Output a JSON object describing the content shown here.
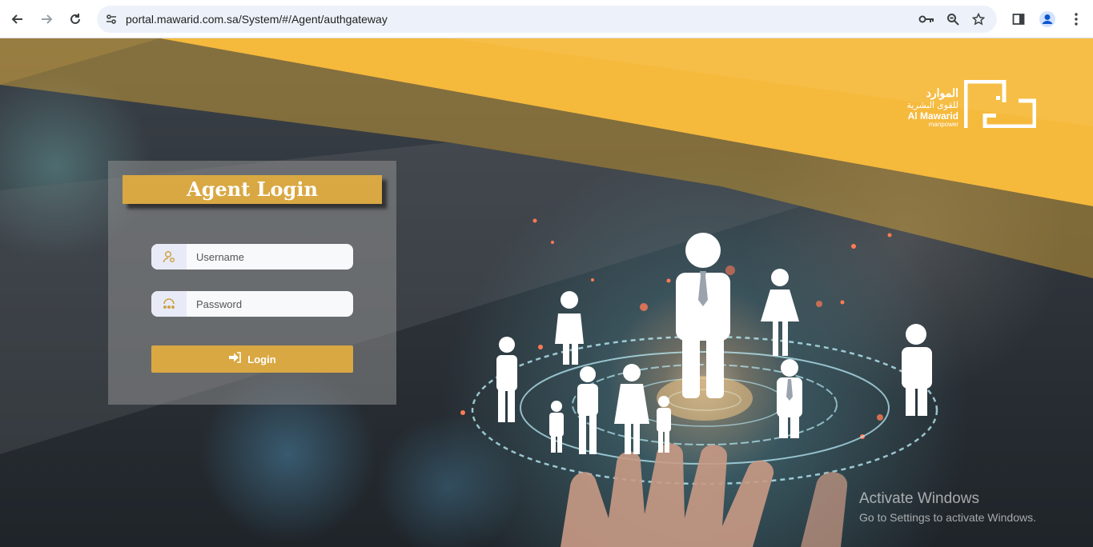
{
  "browser": {
    "url": "portal.mawarid.com.sa/System/#/Agent/authgateway",
    "back_icon": "arrow-left-icon",
    "forward_icon": "arrow-right-icon",
    "reload_icon": "reload-icon",
    "site_info_icon": "tune-icon",
    "password_icon": "key-icon",
    "zoom_icon": "zoom-icon",
    "bookmark_icon": "star-icon",
    "side_panel_icon": "side-panel-icon",
    "profile_icon": "profile-icon",
    "menu_icon": "kebab-menu-icon"
  },
  "logo": {
    "arabic_name": "الموارد",
    "arabic_tagline": "للقوى البشرية",
    "english_name": "Al Mawarid",
    "english_tagline": "manpower"
  },
  "login": {
    "title": "Agent Login",
    "username_placeholder": "Username",
    "password_placeholder": "Password",
    "button_label": "Login"
  },
  "watermark": {
    "line1": "Activate Windows",
    "line2": "Go to Settings to activate Windows."
  },
  "colors": {
    "accent_gold": "#d9a843",
    "banner_yellow": "#f5b93c"
  }
}
